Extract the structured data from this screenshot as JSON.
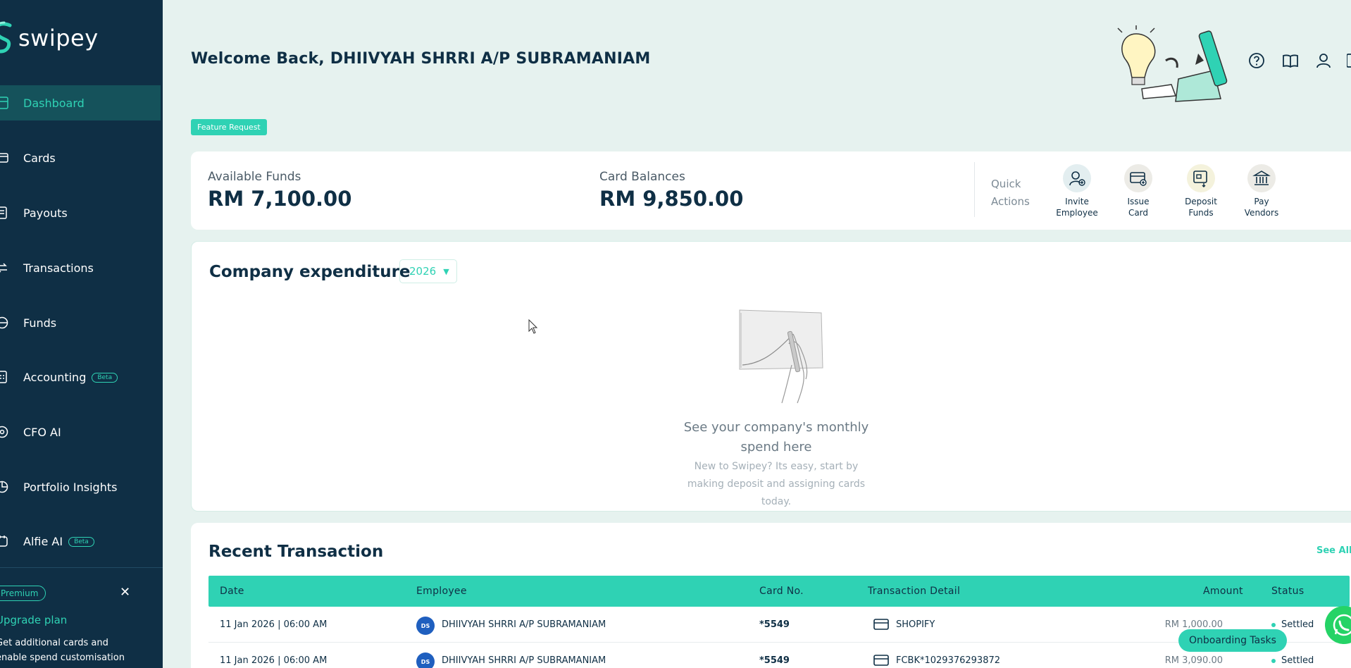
{
  "app": {
    "name": "swipey"
  },
  "sidebar": {
    "items": [
      {
        "label": "Dashboard",
        "icon": "dashboard-icon",
        "active": true
      },
      {
        "label": "Cards",
        "icon": "card-icon"
      },
      {
        "label": "Payouts",
        "icon": "payouts-icon"
      },
      {
        "label": "Transactions",
        "icon": "transactions-icon"
      },
      {
        "label": "Funds",
        "icon": "funds-icon"
      },
      {
        "label": "Accounting",
        "icon": "accounting-icon",
        "badge": "Beta"
      },
      {
        "label": "CFO AI",
        "icon": "cfo-ai-icon"
      },
      {
        "label": "Portfolio Insights",
        "icon": "portfolio-icon"
      },
      {
        "label": "Alfie AI",
        "icon": "alfie-ai-icon",
        "badge": "Beta"
      }
    ],
    "promo": {
      "pill": "Premium",
      "title": "Upgrade plan",
      "line1": "Get additional cards and",
      "line2": "enable spend customisation"
    }
  },
  "header": {
    "welcome": "Welcome Back, DHIIVYAH SHRRI A/P SUBRAMANIAM",
    "feature_request": "Feature Request",
    "icons": [
      "help-icon",
      "guide-book-icon",
      "user-icon",
      "logout-icon"
    ]
  },
  "funds": {
    "available_label": "Available Funds",
    "available_value": "RM 7,100.00",
    "balances_label": "Card Balances",
    "balances_value": "RM 9,850.00",
    "quick_actions_line1": "Quick",
    "quick_actions_line2": "Actions",
    "actions": [
      {
        "line1": "Invite",
        "line2": "Employee",
        "icon": "invite-employee-icon"
      },
      {
        "line1": "Issue",
        "line2": "Card",
        "icon": "issue-card-icon"
      },
      {
        "line1": "Deposit",
        "line2": "Funds",
        "icon": "deposit-funds-icon"
      },
      {
        "line1": "Pay",
        "line2": "Vendors",
        "icon": "pay-vendors-icon"
      }
    ]
  },
  "expenditure": {
    "title": "Company expenditure",
    "year": "2026",
    "empty_title_line1": "See your company's monthly",
    "empty_title_line2": "spend here",
    "empty_sub_line1": "New to Swipey? Its easy, start by",
    "empty_sub_line2": "making deposit and assigning cards",
    "empty_sub_line3": "today."
  },
  "transactions": {
    "title": "Recent Transaction",
    "see_all": "See All",
    "columns": {
      "date": "Date",
      "employee": "Employee",
      "card": "Card No.",
      "detail": "Transaction Detail",
      "amount": "Amount",
      "status": "Status"
    },
    "rows": [
      {
        "date": "11 Jan 2026 | 06:00 AM",
        "initials": "DS",
        "employee": "DHIIVYAH SHRRI A/P SUBRAMANIAM",
        "card": "*5549",
        "detail": "SHOPIFY",
        "amount": "RM 1,000.00",
        "status": "Settled"
      },
      {
        "date": "11 Jan 2026 | 06:00 AM",
        "initials": "DS",
        "employee": "DHIIVYAH SHRRI A/P SUBRAMANIAM",
        "card": "*5549",
        "detail": "FCBK*1029376293872",
        "amount": "RM 3,090.00",
        "status": "Settled"
      }
    ]
  },
  "onboarding": {
    "label": "Onboarding Tasks"
  },
  "colors": {
    "sidebar": "#0f2f45",
    "accent": "#2fd2b4",
    "background": "#e6f2ef",
    "active_item": "#15525b"
  }
}
